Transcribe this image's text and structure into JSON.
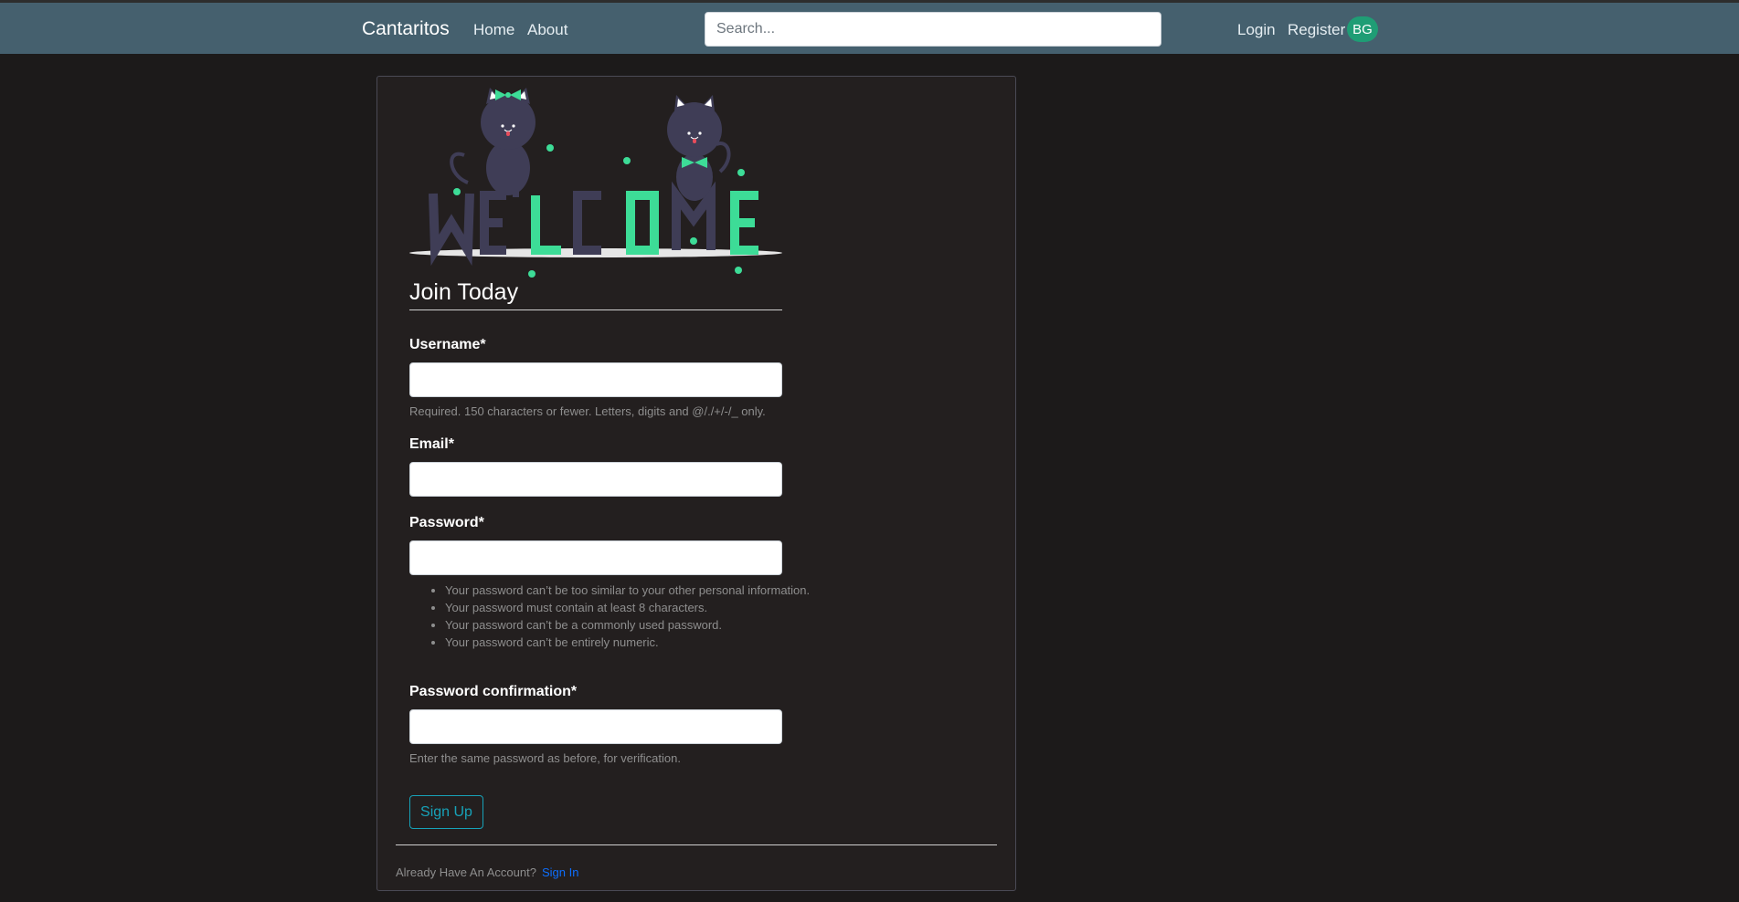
{
  "navbar": {
    "brand": "Cantaritos",
    "links": [
      "Home",
      "About"
    ],
    "search_placeholder": "Search...",
    "right_links": [
      "Login",
      "Register"
    ],
    "avatar_initials": "BG"
  },
  "form": {
    "title": "Join Today",
    "fields": [
      {
        "label": "Username*",
        "value": "",
        "help": "Required. 150 characters or fewer. Letters, digits and @/./+/-/_ only."
      },
      {
        "label": "Email*",
        "value": ""
      },
      {
        "label": "Password*",
        "value": "",
        "help_items": [
          "Your password can’t be too similar to your other personal information.",
          "Your password must contain at least 8 characters.",
          "Your password can’t be a commonly used password.",
          "Your password can’t be entirely numeric."
        ]
      },
      {
        "label": "Password confirmation*",
        "value": "",
        "help": "Enter the same password as before, for verification."
      }
    ],
    "submit_label": "Sign Up"
  },
  "footer": {
    "prompt": "Already Have An Account?",
    "signin_label": "Sign In"
  },
  "colors": {
    "navbar_bg": "#45606e",
    "page_bg": "#1c1a1a",
    "card_bg": "#231f1f",
    "accent_teal": "#17a2b8",
    "illustration_green": "#3ddc97",
    "link_blue": "#0d6efd"
  }
}
